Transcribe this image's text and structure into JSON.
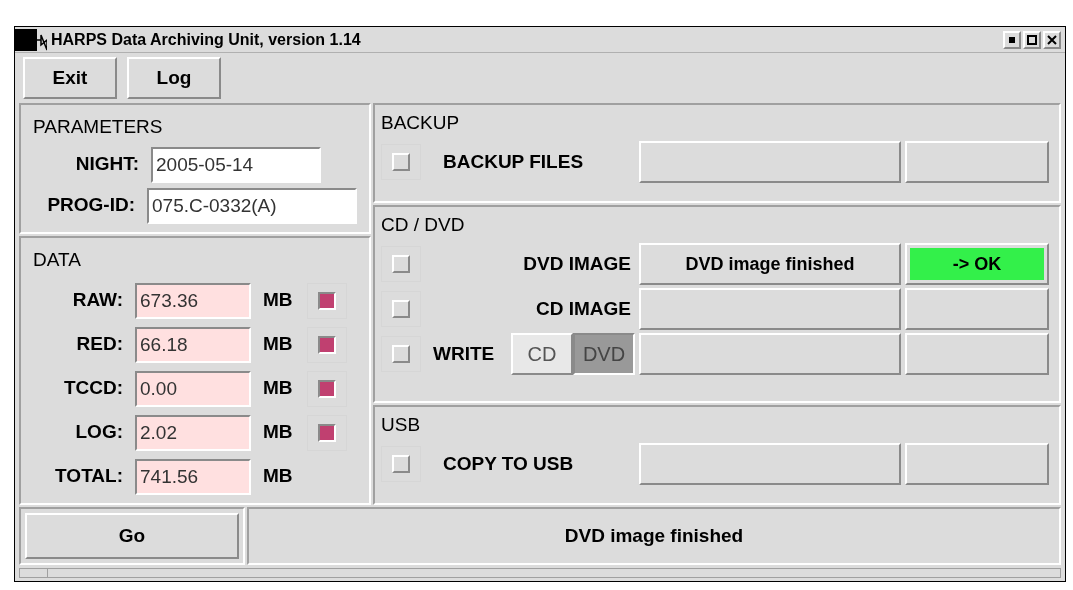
{
  "window": {
    "title": "HARPS Data Archiving Unit, version 1.14"
  },
  "toolbar": [
    "Exit",
    "Log"
  ],
  "parameters": {
    "title": "PARAMETERS",
    "fields": [
      {
        "label": "NIGHT:",
        "value": "2005-05-14"
      },
      {
        "label": "PROG-ID:",
        "value": "075.C-0332(A)"
      }
    ]
  },
  "data": {
    "title": "DATA",
    "rows": [
      {
        "label": "RAW:",
        "value": "673.36",
        "unit": "MB",
        "indicator": true
      },
      {
        "label": "RED:",
        "value": "66.18",
        "unit": "MB",
        "indicator": true
      },
      {
        "label": "TCCD:",
        "value": "0.00",
        "unit": "MB",
        "indicator": true
      },
      {
        "label": "LOG:",
        "value": "2.02",
        "unit": "MB",
        "indicator": true
      },
      {
        "label": "TOTAL:",
        "value": "741.56",
        "unit": "MB",
        "indicator": false
      }
    ]
  },
  "sections": [
    {
      "title": "BACKUP",
      "rows": [
        {
          "kind": "task",
          "label": "BACKUP FILES",
          "checked": false
        }
      ]
    },
    {
      "title": "CD / DVD",
      "rows": [
        {
          "kind": "task",
          "label": "DVD IMAGE",
          "checked": false,
          "status": "DVD image finished",
          "result": "-> OK",
          "result_ok": true
        },
        {
          "kind": "task",
          "label": "CD IMAGE",
          "checked": false
        },
        {
          "kind": "write",
          "label": "WRITE",
          "checked": false,
          "media": [
            {
              "label": "CD",
              "selected": false
            },
            {
              "label": "DVD",
              "selected": true
            }
          ]
        }
      ]
    },
    {
      "title": "USB",
      "rows": [
        {
          "kind": "task",
          "label": "COPY TO USB",
          "checked": false
        }
      ]
    }
  ],
  "go_button": "Go",
  "status_bar": "DVD image finished"
}
